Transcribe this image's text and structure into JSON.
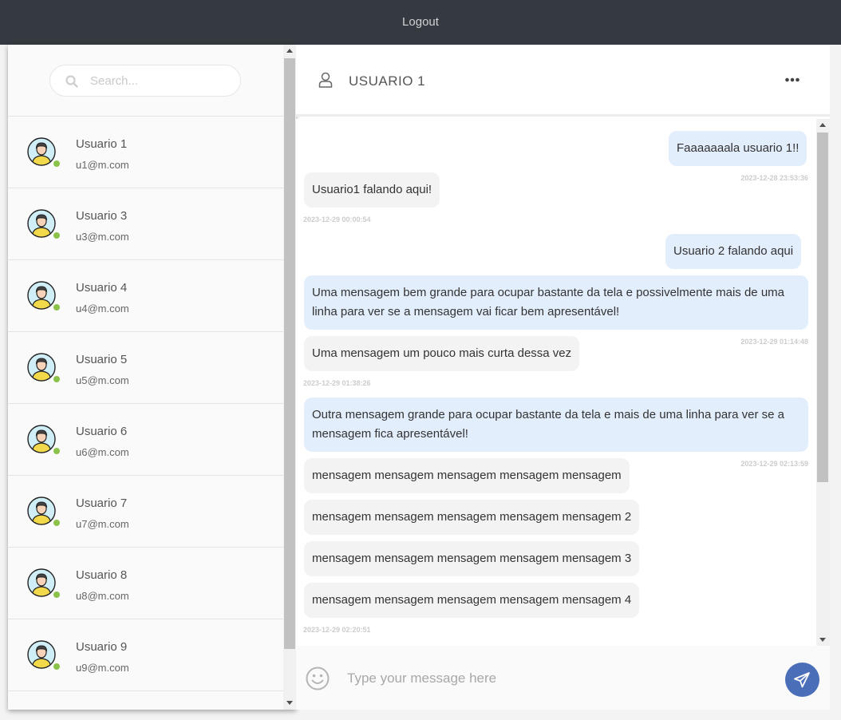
{
  "topbar": {
    "logout_label": "Logout"
  },
  "search": {
    "placeholder": "Search..."
  },
  "contacts": [
    {
      "name": "Usuario 1",
      "email": "u1@m.com",
      "status": "online"
    },
    {
      "name": "Usuario 3",
      "email": "u3@m.com",
      "status": "online"
    },
    {
      "name": "Usuario 4",
      "email": "u4@m.com",
      "status": "online"
    },
    {
      "name": "Usuario 5",
      "email": "u5@m.com",
      "status": "online"
    },
    {
      "name": "Usuario 6",
      "email": "u6@m.com",
      "status": "online"
    },
    {
      "name": "Usuario 7",
      "email": "u7@m.com",
      "status": "online"
    },
    {
      "name": "Usuario 8",
      "email": "u8@m.com",
      "status": "online"
    },
    {
      "name": "Usuario 9",
      "email": "u9@m.com",
      "status": "online"
    }
  ],
  "chat": {
    "title": "USUARIO 1",
    "messages": [
      {
        "side": "right",
        "text": "Faaaaaaala usuario 1!!",
        "time": "2023-12-28 23:53:36"
      },
      {
        "side": "left",
        "text": "Usuario1 falando aqui!",
        "time": "2023-12-29 00:00:54"
      },
      {
        "side": "right",
        "text": "Usuario 2 falando aqui",
        "time": ""
      },
      {
        "side": "right",
        "text": "Uma mensagem bem grande para ocupar bastante da tela e possivelmente mais de uma linha para ver se a mensagem vai ficar bem apresentável!",
        "time": "2023-12-29 01:14:48"
      },
      {
        "side": "left",
        "text": "Uma mensagem um pouco mais curta dessa vez",
        "time": "2023-12-29 01:38:26"
      },
      {
        "side": "right",
        "text": "Outra mensagem grande para ocupar bastante da tela e mais de uma linha para ver se a mensagem fica apresentável!",
        "time": "2023-12-29 02:13:59"
      },
      {
        "side": "left",
        "text": "mensagem mensagem mensagem mensagem mensagem",
        "time": ""
      },
      {
        "side": "left",
        "text": "mensagem mensagem mensagem mensagem mensagem 2",
        "time": ""
      },
      {
        "side": "left",
        "text": "mensagem mensagem mensagem mensagem mensagem 3",
        "time": ""
      },
      {
        "side": "left",
        "text": "mensagem mensagem mensagem mensagem mensagem 4",
        "time": "2023-12-29 02:20:51"
      }
    ]
  },
  "composer": {
    "placeholder": "Type your message here"
  },
  "colors": {
    "topbar": "#343a40",
    "outgoing_bubble": "#e3eefc",
    "incoming_bubble": "#f3f3f3",
    "online_status": "#8bc34a",
    "send_button": "#4a6fb8"
  },
  "icons": {
    "search": "search-icon",
    "avatar": "user-avatar-icon",
    "header_user": "user-outline-icon",
    "more": "ellipsis-icon",
    "emoji": "smiley-icon",
    "send": "paper-plane-icon"
  }
}
